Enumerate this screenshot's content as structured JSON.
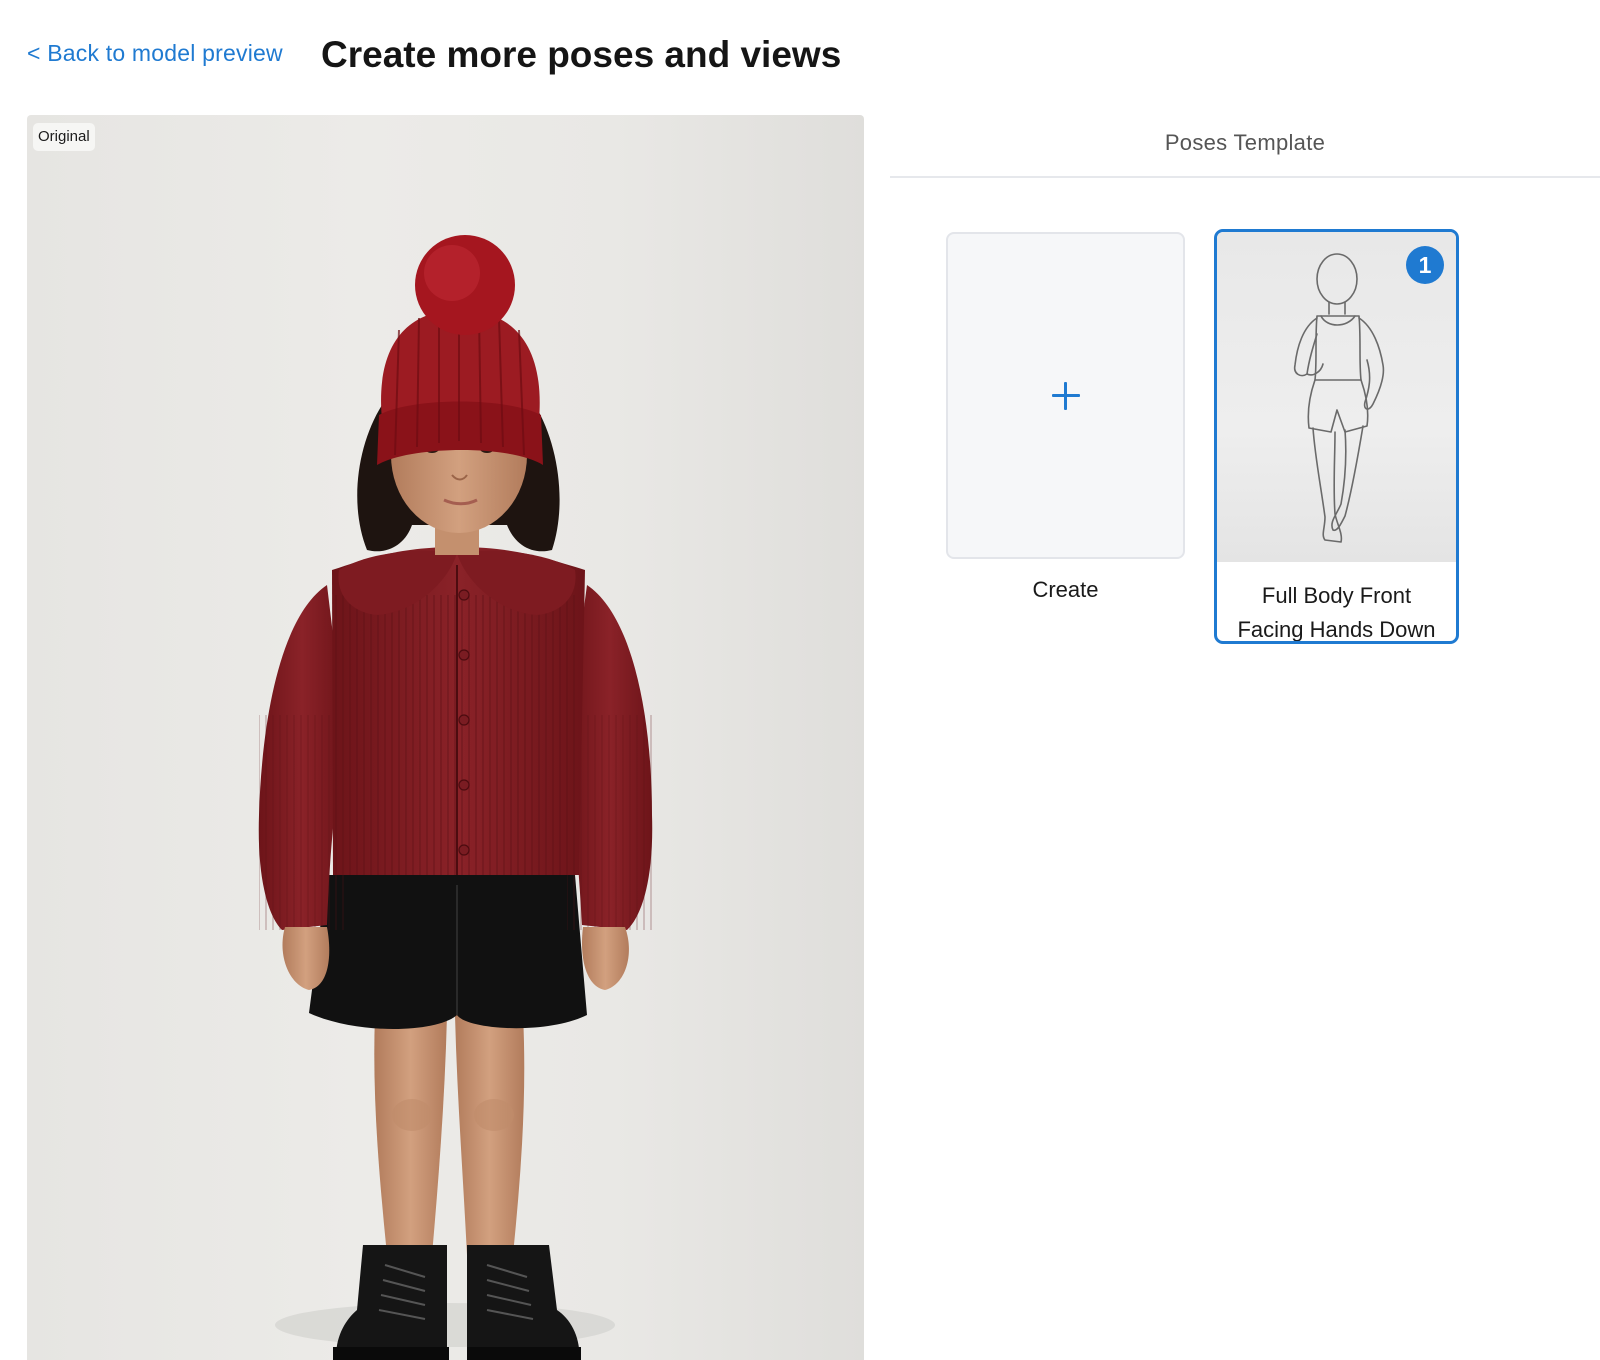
{
  "header": {
    "back_link": "< Back to model preview",
    "title": "Create more poses and views"
  },
  "preview": {
    "badge": "Original",
    "image_subject": "child in red knit cardigan, red pom-pom beanie, black shorts and black boots"
  },
  "panel": {
    "tab_label": "Poses Template",
    "accent_color": "#1f7ad1",
    "cards": [
      {
        "label": "Create",
        "icon": "plus-icon"
      },
      {
        "label_line1": "Full Body Front",
        "label_line2": "Facing Hands Down",
        "selected": true,
        "badge": "1"
      }
    ]
  }
}
